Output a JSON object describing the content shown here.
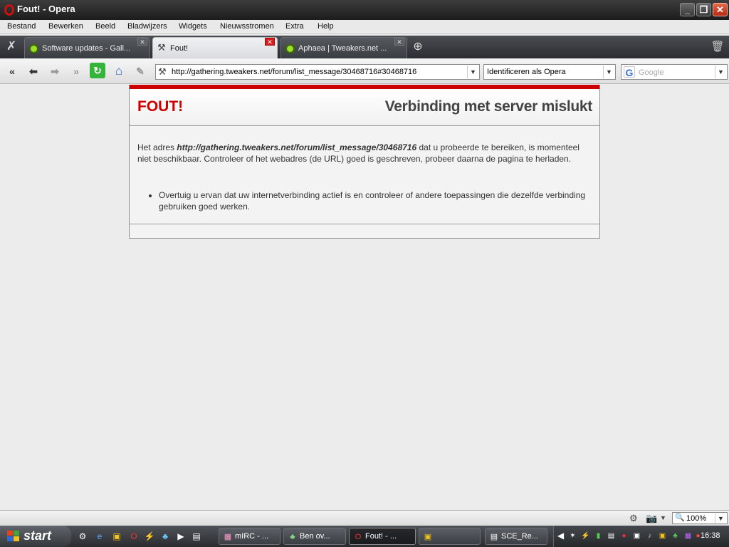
{
  "window": {
    "title": "Fout! - Opera"
  },
  "menu": [
    "Bestand",
    "Bewerken",
    "Beeld",
    "Bladwijzers",
    "Widgets",
    "Nieuwsstromen",
    "Extra",
    "Help"
  ],
  "tabs": [
    {
      "label": "Software updates - Gall..."
    },
    {
      "label": "Fout!"
    },
    {
      "label": "Aphaea | Tweakers.net ..."
    }
  ],
  "toolbar": {
    "url": "http://gathering.tweakers.net/forum/list_message/30468716#30468716",
    "identify_as": "Identificeren als Opera",
    "search_placeholder": "Google",
    "search_engine_letter": "G"
  },
  "error": {
    "label": "FOUT!",
    "heading": "Verbinding met server mislukt",
    "text_before": "Het adres ",
    "address": "http://gathering.tweakers.net/forum/list_message/30468716",
    "text_after": " dat u probeerde te bereiken, is momenteel niet beschikbaar. Controleer of het webadres (de URL) goed is geschreven, probeer daarna de pagina te herladen.",
    "bullet": "Overtuig u ervan dat uw internetverbinding actief is en controleer of andere toepassingen die dezelfde verbinding gebruiken goed werken."
  },
  "status": {
    "zoom": "100%"
  },
  "taskbar": {
    "start_label": "start",
    "tasks": [
      {
        "label": "mIRC - ..."
      },
      {
        "label": "Ben ov..."
      },
      {
        "label": "Fout! - ..."
      },
      {
        "label": ""
      },
      {
        "label": "SCE_Re..."
      }
    ],
    "clock": "16:38"
  }
}
